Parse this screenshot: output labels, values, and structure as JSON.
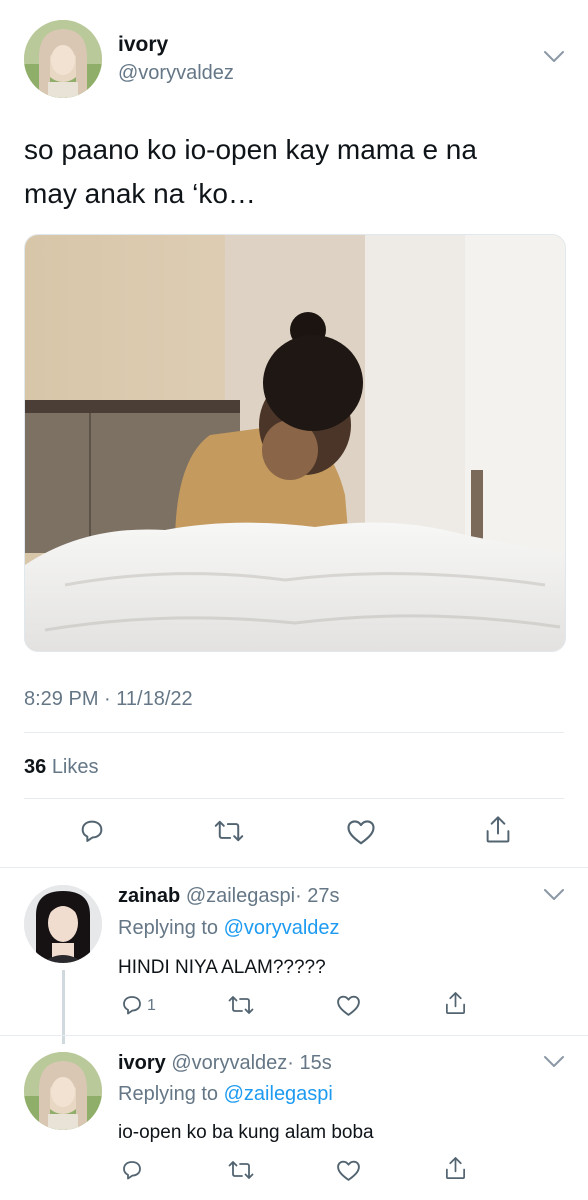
{
  "main_tweet": {
    "display_name": "ivory",
    "handle": "@voryvaldez",
    "text_line1": "so paano ko io-open kay mama e na",
    "text_line2": "may anak na ‘ko…",
    "timestamp": "8:29 PM · 11/18/22",
    "likes_count": "36",
    "likes_label": "Likes"
  },
  "replies": [
    {
      "display_name": "zainab",
      "handle": "@zailegaspi",
      "time": "· 27s",
      "replying_prefix": "Replying to",
      "replying_to": "@voryvaldez",
      "text": "HINDI NIYA ALAM?????",
      "reply_count": "1"
    },
    {
      "display_name": "ivory",
      "handle": "@voryvaldez",
      "time": "· 15s",
      "replying_prefix": "Replying to",
      "replying_to": "@zailegaspi",
      "text": "io-open ko ba kung alam boba"
    }
  ],
  "colors": {
    "link_blue": "#1d9bf0",
    "muted_grey": "#657786",
    "divider": "#e6ecf0"
  },
  "icons": [
    "chevron-down-icon",
    "reply-icon",
    "retweet-icon",
    "like-icon",
    "share-icon"
  ]
}
